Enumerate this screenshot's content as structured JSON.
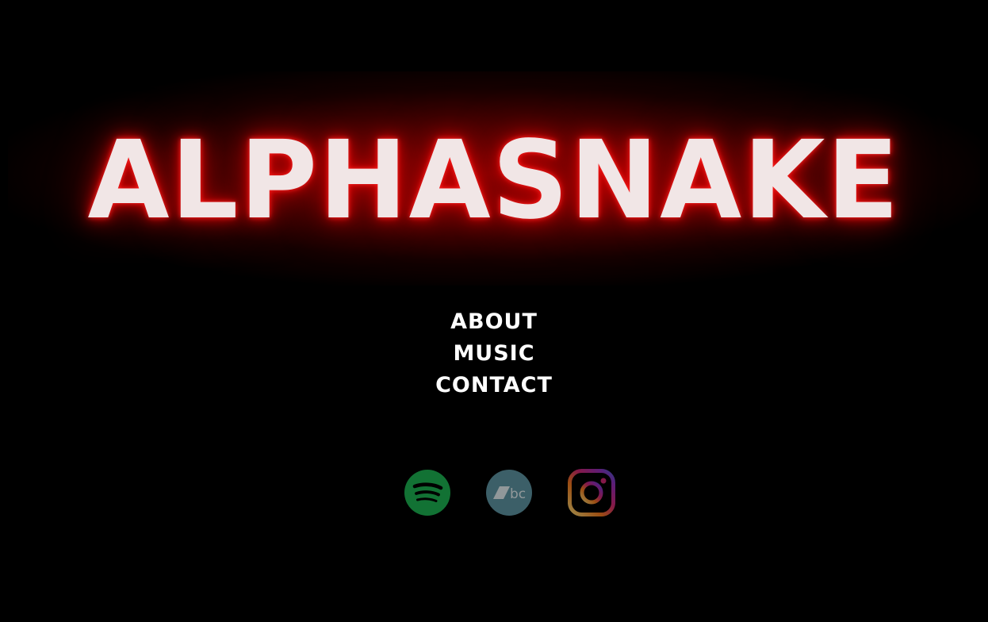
{
  "logo": {
    "text": "ALPHASNAKE",
    "color": "#f1e6e6",
    "glow_color": "#c80000"
  },
  "nav": {
    "items": [
      {
        "label": "ABOUT"
      },
      {
        "label": "MUSIC"
      },
      {
        "label": "CONTACT"
      }
    ]
  },
  "socials": {
    "items": [
      {
        "icon": "spotify-icon",
        "color": "#1db954"
      },
      {
        "icon": "bandcamp-icon",
        "text": "bc",
        "color": "#629aa9"
      },
      {
        "icon": "instagram-icon",
        "color": "#e1306c"
      }
    ]
  },
  "background": "#000000"
}
